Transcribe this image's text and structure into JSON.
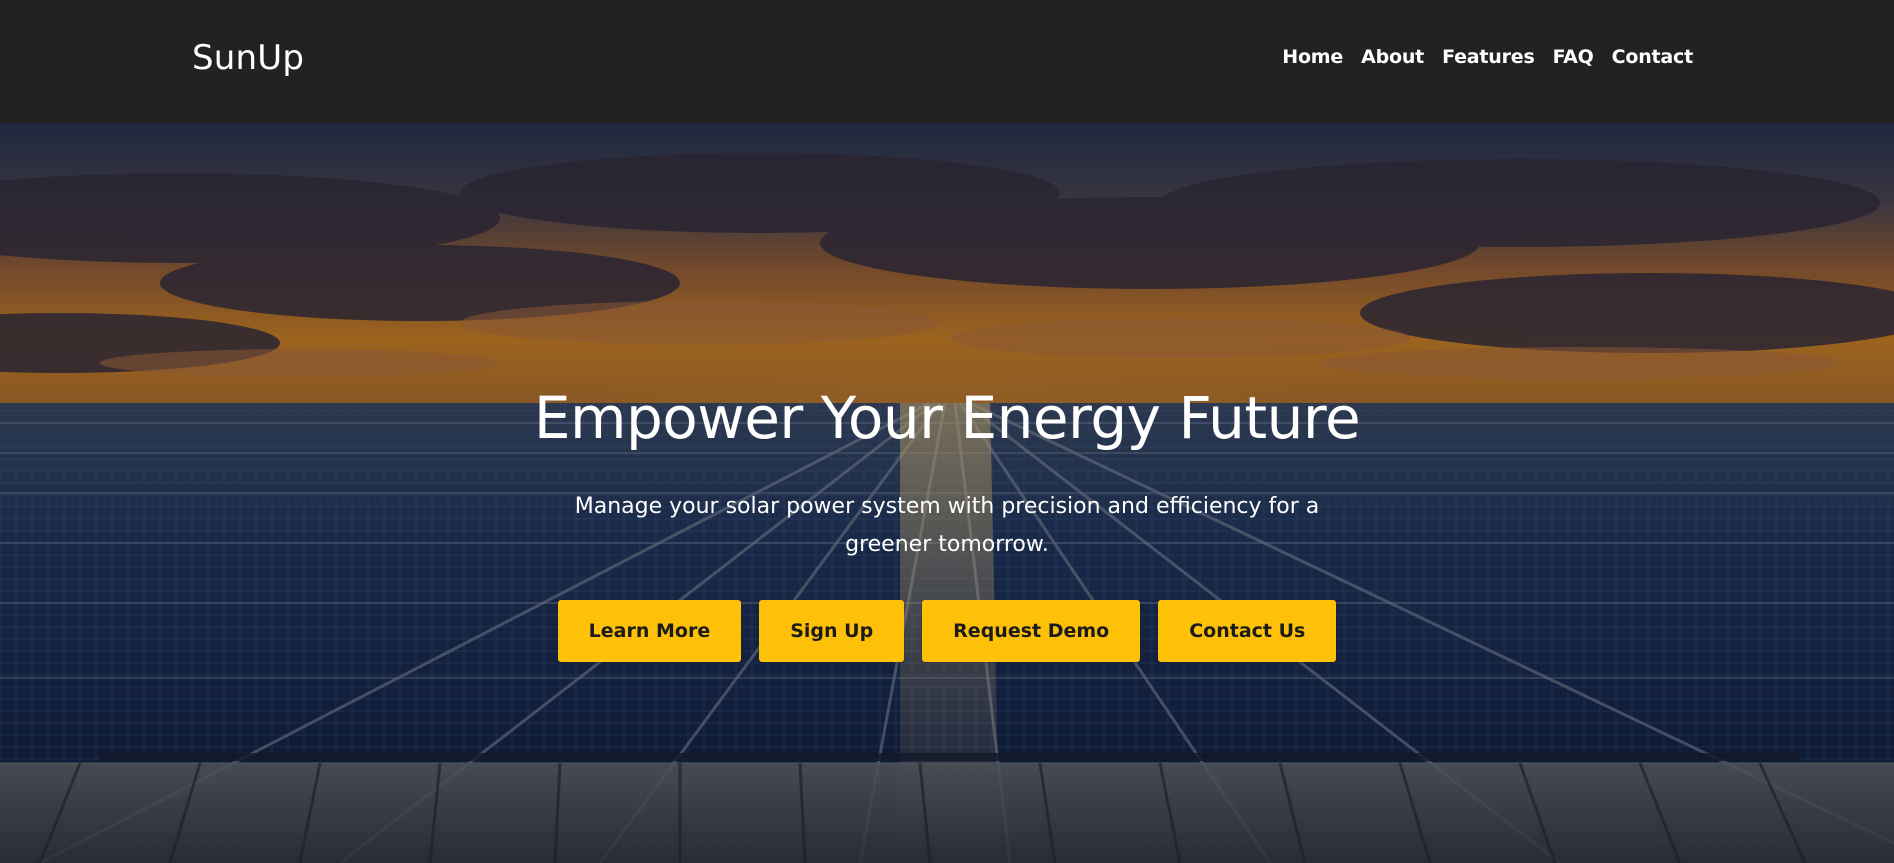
{
  "brand": {
    "name": "SunUp"
  },
  "nav": {
    "items": [
      {
        "label": "Home"
      },
      {
        "label": "About"
      },
      {
        "label": "Features"
      },
      {
        "label": "FAQ"
      },
      {
        "label": "Contact"
      }
    ]
  },
  "hero": {
    "title": "Empower Your Energy Future",
    "subtitle": "Manage your solar power system with precision and efficiency for a greener tomorrow.",
    "buttons": [
      {
        "label": "Learn More"
      },
      {
        "label": "Sign Up"
      },
      {
        "label": "Request Demo"
      },
      {
        "label": "Contact Us"
      }
    ],
    "background_image": "sunset-over-solar-panel-rooftop"
  },
  "colors": {
    "header_bg": "#222222",
    "accent": "#ffc107",
    "button_text": "#1b1b1b",
    "text": "#ffffff"
  }
}
